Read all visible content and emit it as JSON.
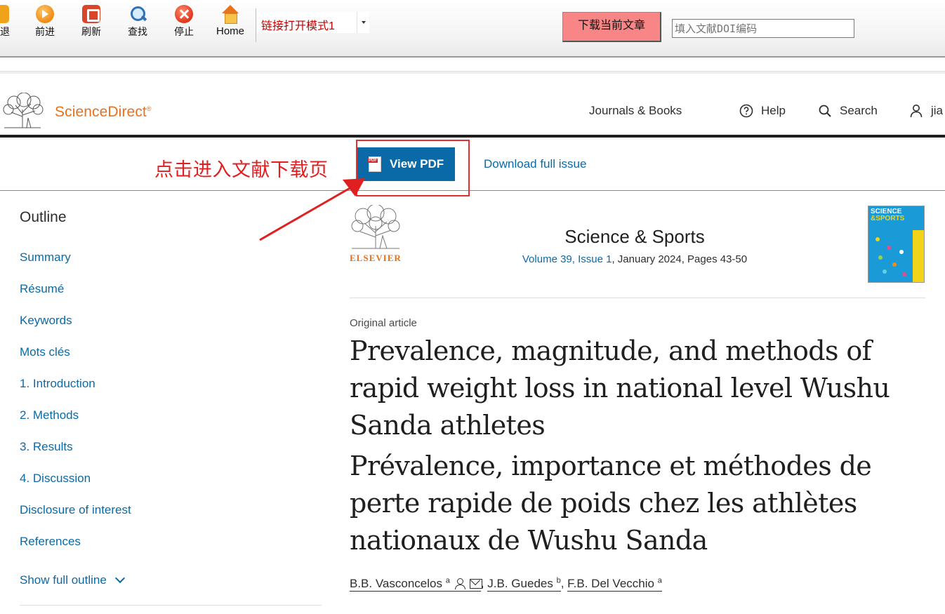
{
  "toolbar": {
    "back_label": "退",
    "forward_label": "前进",
    "refresh_label": "刷新",
    "find_label": "查找",
    "stop_label": "停止",
    "home_label": "Home",
    "mode_select_value": "链接打开模式1",
    "download_button": "下载当前文章",
    "doi_placeholder": "填入文献DOI编码"
  },
  "site_header": {
    "brand": "ScienceDirect",
    "brand_mark": "®",
    "nav": {
      "journals_books": "Journals & Books",
      "help": "Help",
      "search": "Search",
      "user": "jia"
    }
  },
  "action_bar": {
    "annotation": "点击进入文献下载页",
    "view_pdf": "View PDF",
    "download_issue": "Download full issue"
  },
  "outline": {
    "title": "Outline",
    "items": [
      {
        "label": "Summary"
      },
      {
        "label": "Résumé"
      },
      {
        "label": "Keywords"
      },
      {
        "label": "Mots clés"
      },
      {
        "label": "1. Introduction"
      },
      {
        "label": "2. Methods"
      },
      {
        "label": "3. Results"
      },
      {
        "label": "4. Discussion"
      },
      {
        "label": "Disclosure of interest"
      },
      {
        "label": "References"
      }
    ],
    "show_full": "Show full outline"
  },
  "journal": {
    "publisher": "ELSEVIER",
    "name": "Science & Sports",
    "volume_issue": "Volume 39, Issue 1",
    "date_pages": ", January 2024, Pages 43-50",
    "cover_line1": "SCIENCE",
    "cover_line2": "&SPORTS"
  },
  "article": {
    "type": "Original article",
    "title_en": "Prevalence, magnitude, and methods of rapid weight loss in national level Wushu Sanda athletes",
    "title_fr": "Prévalence, importance et méthodes de perte rapide de poids chez les athlètes nationaux de Wushu Sanda",
    "authors": [
      {
        "name": "B.B. Vasconcelos",
        "affil": "a"
      },
      {
        "name": "J.B. Guedes",
        "affil": "b"
      },
      {
        "name": "F.B. Del Vecchio",
        "affil": "a"
      }
    ]
  },
  "colors": {
    "brand_orange": "#e9711c",
    "link_blue": "#0b6aa6",
    "pdf_button": "#0a6aa8",
    "annotation_red": "#e02020",
    "download_button_bg": "#f88686"
  },
  "icons": [
    "back-icon",
    "forward-icon",
    "refresh-icon",
    "find-icon",
    "stop-icon",
    "home-icon",
    "help-icon",
    "search-icon",
    "user-icon",
    "pdf-icon",
    "chevron-down-icon",
    "person-icon",
    "mail-icon"
  ]
}
